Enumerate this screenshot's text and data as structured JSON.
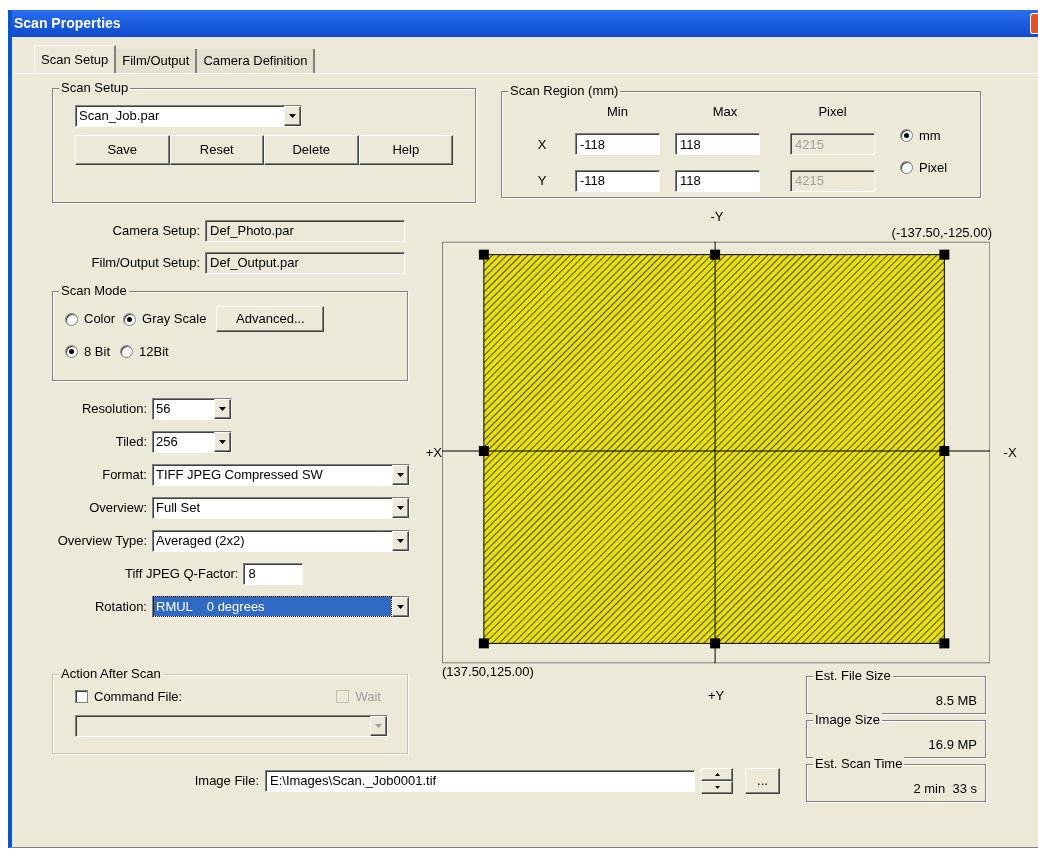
{
  "window": {
    "title": "Scan Properties"
  },
  "tabs": [
    {
      "label": "Scan Setup",
      "selected": true
    },
    {
      "label": "Film/Output",
      "selected": false
    },
    {
      "label": "Camera Definition",
      "selected": false
    }
  ],
  "scan_setup": {
    "title": "Scan Setup",
    "file": "Scan_Job.par",
    "buttons": [
      "Save",
      "Reset",
      "Delete",
      "Help"
    ]
  },
  "scan_region": {
    "title": "Scan Region (mm)",
    "columns": [
      "Min",
      "Max",
      "Pixel"
    ],
    "rows": [
      {
        "axis": "X",
        "min": "-118",
        "max": "118",
        "pixel": "4215"
      },
      {
        "axis": "Y",
        "min": "-118",
        "max": "118",
        "pixel": "4215"
      }
    ],
    "units": [
      {
        "label": "mm",
        "selected": true
      },
      {
        "label": "Pixel",
        "selected": false
      }
    ]
  },
  "setups": [
    {
      "label": "Camera Setup:",
      "value": "Def_Photo.par"
    },
    {
      "label": "Film/Output Setup:",
      "value": "Def_Output.par"
    }
  ],
  "scan_mode": {
    "title": "Scan Mode",
    "color_modes": [
      {
        "label": "Color",
        "selected": false
      },
      {
        "label": "Gray Scale",
        "selected": true
      }
    ],
    "advanced_button": "Advanced...",
    "bit_depths": [
      {
        "label": "8 Bit",
        "selected": true
      },
      {
        "label": "12Bit",
        "selected": false
      }
    ]
  },
  "settings": [
    {
      "kind": "short_dropdown",
      "label": "Resolution:",
      "value": "56",
      "focused": false
    },
    {
      "kind": "short_dropdown",
      "label": "Tiled:",
      "value": "256",
      "focused": false
    },
    {
      "kind": "dropdown",
      "label": "Format:",
      "value": "TIFF JPEG Compressed SW",
      "focused": false
    },
    {
      "kind": "dropdown",
      "label": "Overview:",
      "value": "Full Set",
      "focused": false
    },
    {
      "kind": "dropdown",
      "label": "Overview Type:",
      "value": "Averaged (2x2)",
      "focused": false
    },
    {
      "kind": "text",
      "label": "Tiff JPEG Q-Factor:",
      "value": "8"
    },
    {
      "kind": "dropdown",
      "label": "Rotation:",
      "value": "RMUL    0 degrees",
      "focused": true
    }
  ],
  "action_after_scan": {
    "title": "Action After Scan",
    "command_file": {
      "label": "Command File:",
      "checked": false
    },
    "wait": {
      "label": "Wait",
      "checked": false,
      "disabled": true
    }
  },
  "preview": {
    "top_label": "-Y",
    "top_right": "(-137.50,-125.00)",
    "left_label": "+X",
    "right_label": "-X",
    "bottom_left": "(137.50,125.00)",
    "bottom_label": "+Y"
  },
  "image_file": {
    "label": "Image File:",
    "value": "E:\\Images\\Scan._Job0001.tif",
    "browse_button": "..."
  },
  "estimates": [
    {
      "title": "Est. File Size",
      "value": "8.5 MB"
    },
    {
      "title": "Image Size",
      "value": "16.9 MP"
    },
    {
      "title": "Est. Scan Time",
      "value": "2 min  33 s"
    }
  ]
}
